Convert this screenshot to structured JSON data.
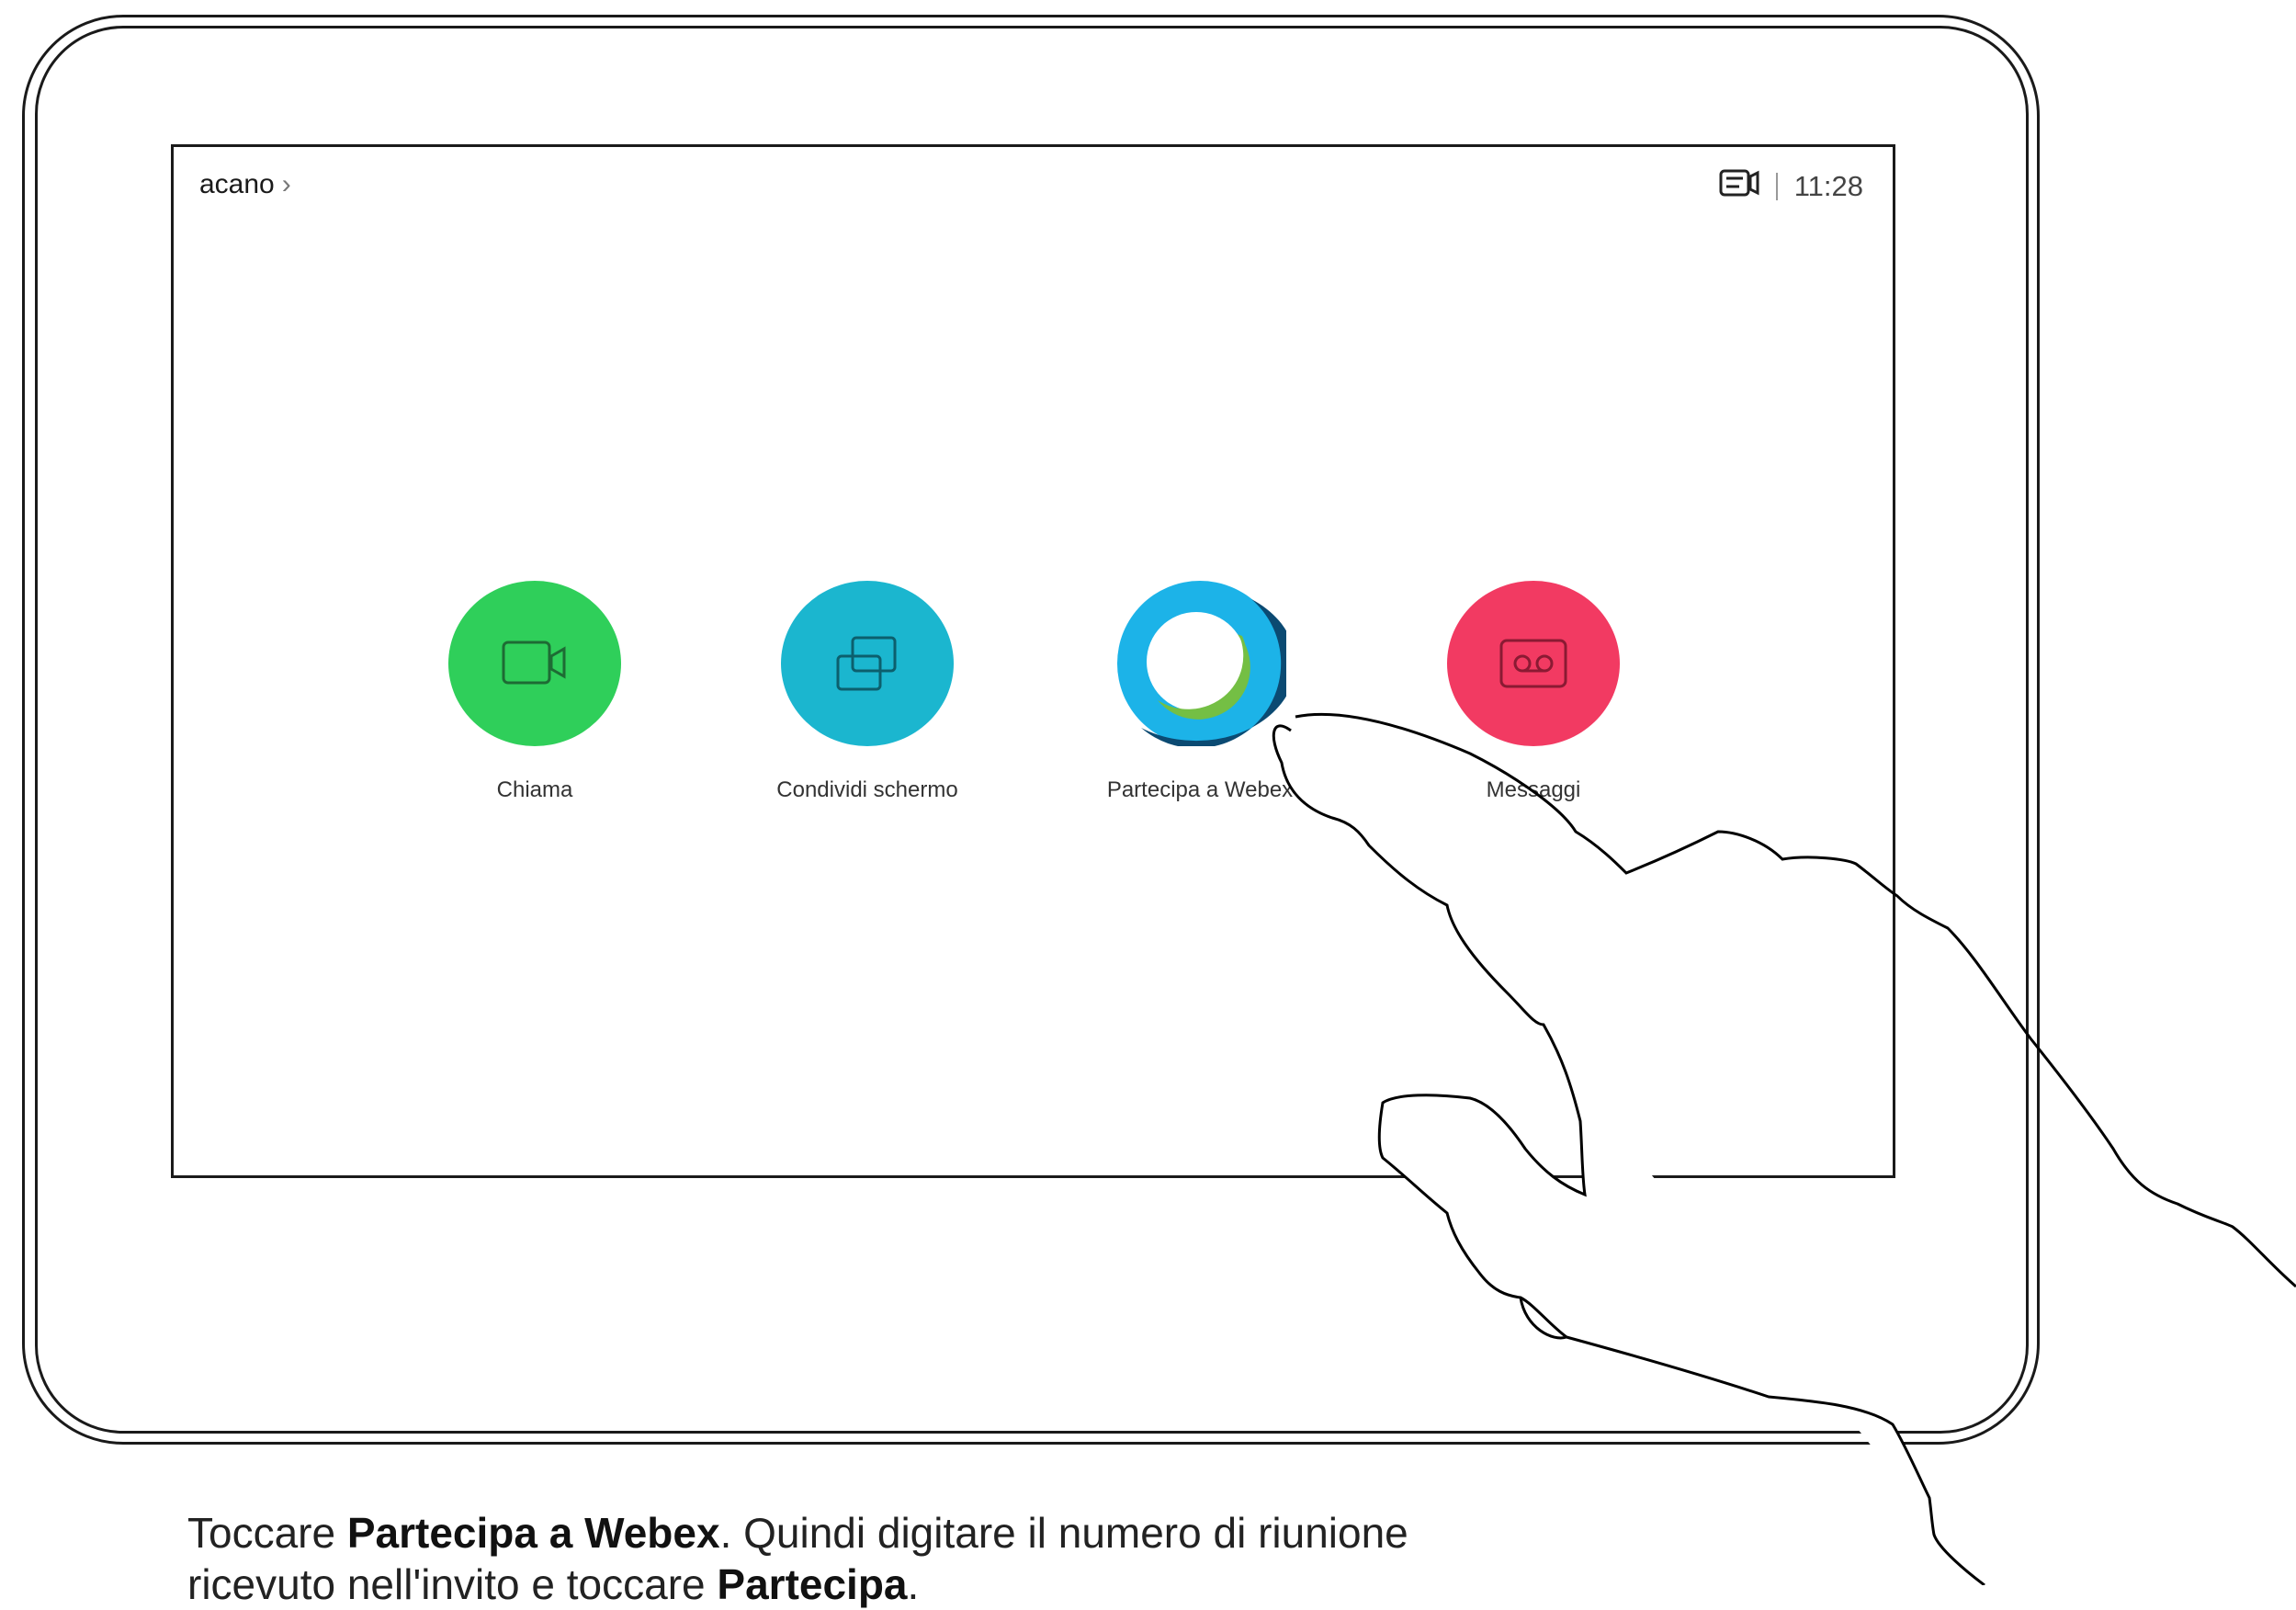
{
  "topbar": {
    "device_name": "acano",
    "chevron": "›",
    "camera_icon": "camera-selfview-icon",
    "time": "11:28"
  },
  "tiles": [
    {
      "label": "Chiama",
      "icon": "video-call-icon",
      "color": "#2fcf5a"
    },
    {
      "label": "Condividi schermo",
      "icon": "share-screen-icon",
      "color": "#1bb6cf"
    },
    {
      "label": "Partecipa a Webex",
      "icon": "webex-logo-icon",
      "color": "#0b4a72"
    },
    {
      "label": "Messaggi",
      "icon": "voicemail-icon",
      "color": "#f23a62"
    }
  ],
  "caption": {
    "part1": "Toccare ",
    "bold1": "Partecipa a Webex",
    "part2": ". Quindi digitare il numero di riunione",
    "part3": "ricevuto nell'invito e toccare ",
    "bold2": "Partecipa",
    "part4": "."
  }
}
